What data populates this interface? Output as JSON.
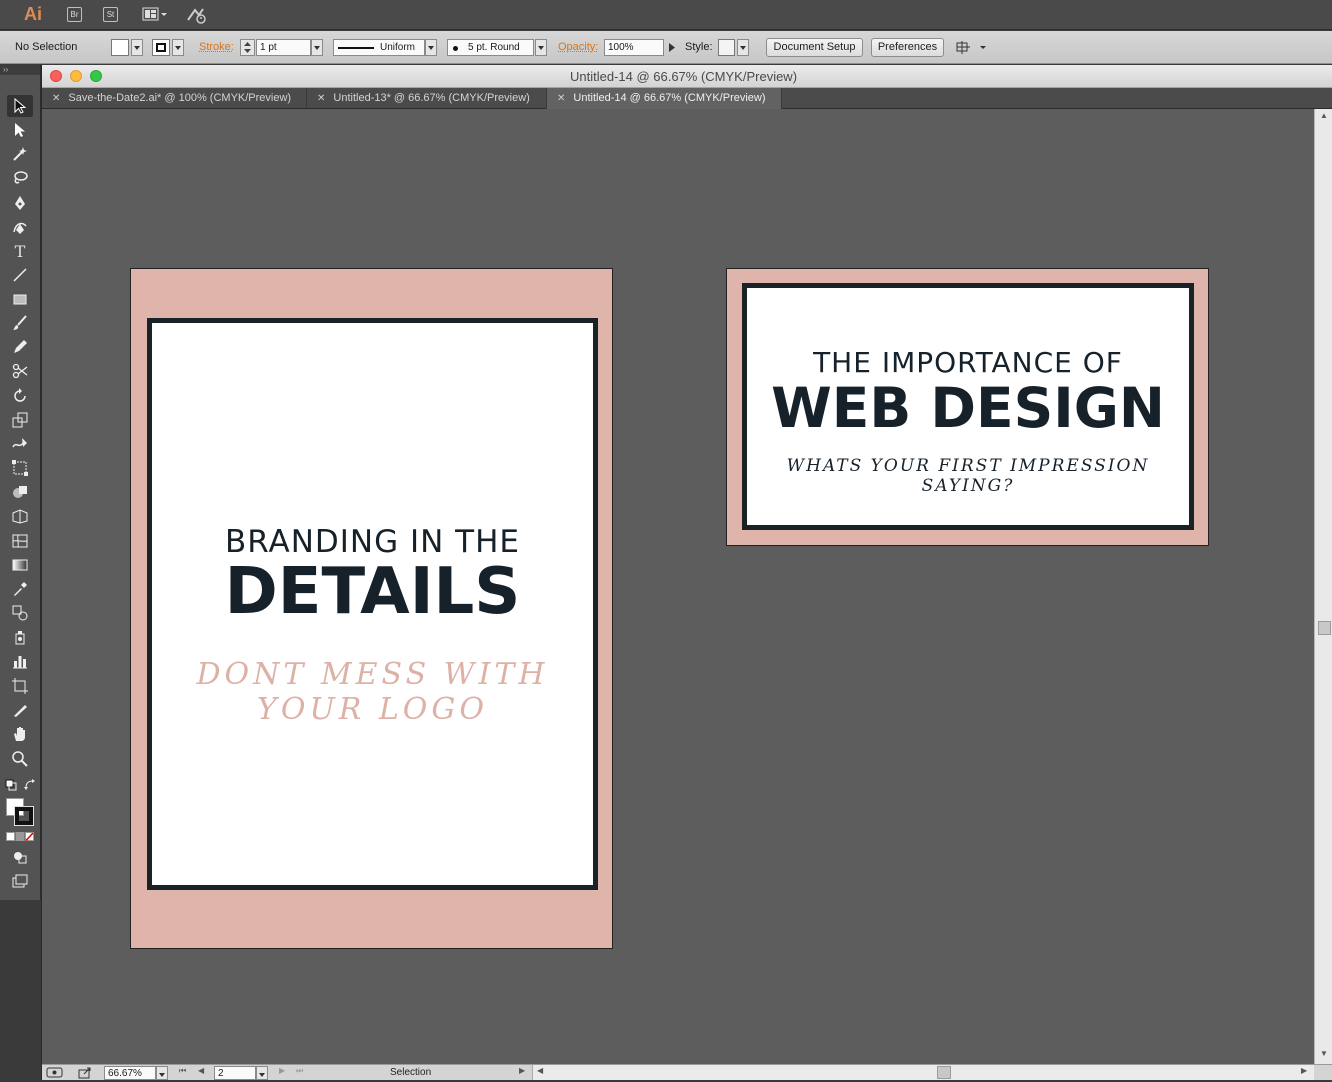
{
  "app": {
    "logo": "Ai",
    "buttons": [
      "Br",
      "St"
    ]
  },
  "controlbar": {
    "selection_status": "No Selection",
    "stroke_label": "Stroke:",
    "stroke_weight": "1 pt",
    "stroke_profile": "Uniform",
    "brush": "5 pt. Round",
    "opacity_label": "Opacity:",
    "opacity_value": "100%",
    "style_label": "Style:",
    "document_setup": "Document Setup",
    "preferences": "Preferences"
  },
  "window": {
    "title": "Untitled-14 @ 66.67% (CMYK/Preview)"
  },
  "tabs": [
    {
      "label": "Save-the-Date2.ai* @ 100% (CMYK/Preview)",
      "active": false
    },
    {
      "label": "Untitled-13* @ 66.67% (CMYK/Preview)",
      "active": false
    },
    {
      "label": "Untitled-14 @ 66.67% (CMYK/Preview)",
      "active": true
    }
  ],
  "artboard1": {
    "line1": "BRANDING IN THE",
    "line2": "DETAILS",
    "script": "DONT MESS WITH YOUR LOGO",
    "script_color": "#deb1a6"
  },
  "artboard2": {
    "line1": "THE IMPORTANCE OF",
    "line2": "WEB DESIGN",
    "script": "WHATS YOUR FIRST IMPRESSION SAYING?",
    "script_color": "#16212a"
  },
  "colors": {
    "artboard_bg": "#dfb4aa",
    "frame": "#182227",
    "pasteboard": "#5d5d5d"
  },
  "statusbar": {
    "zoom": "66.67%",
    "artboard_number": "2",
    "current_tool": "Selection"
  }
}
